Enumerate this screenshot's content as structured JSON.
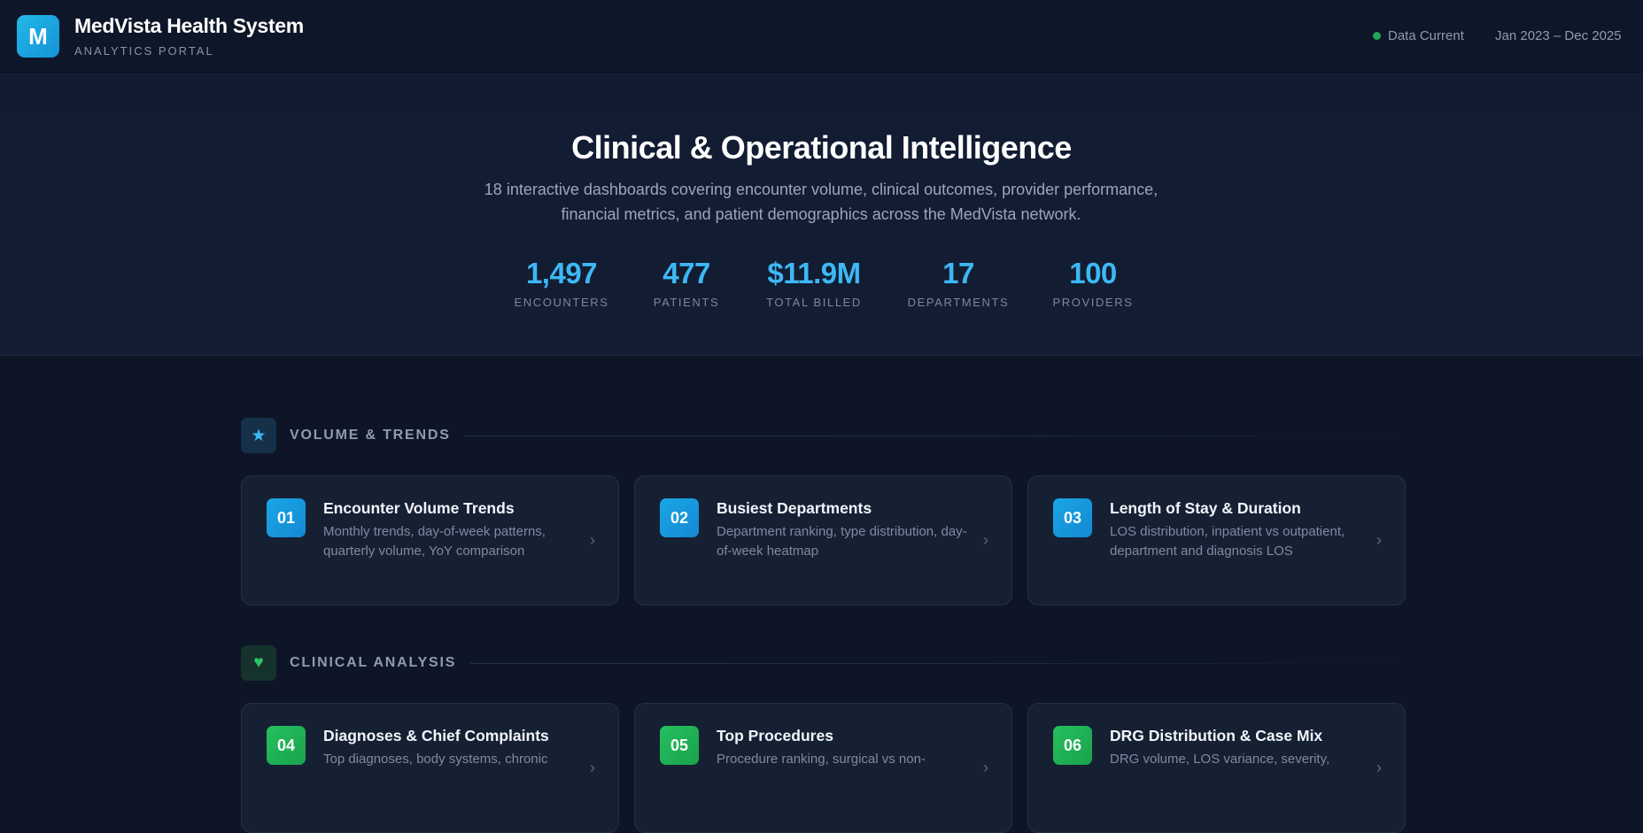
{
  "header": {
    "logo_letter": "M",
    "title": "MedVista Health System",
    "subtitle": "ANALYTICS PORTAL",
    "status": "Data Current",
    "date_range": "Jan 2023 – Dec 2025"
  },
  "hero": {
    "title": "Clinical & Operational Intelligence",
    "description": "18 interactive dashboards covering encounter volume, clinical outcomes, provider performance, financial metrics, and patient demographics across the MedVista network.",
    "stats": [
      {
        "value": "1,497",
        "label": "ENCOUNTERS"
      },
      {
        "value": "477",
        "label": "PATIENTS"
      },
      {
        "value": "$11.9M",
        "label": "TOTAL BILLED"
      },
      {
        "value": "17",
        "label": "DEPARTMENTS"
      },
      {
        "value": "100",
        "label": "PROVIDERS"
      }
    ]
  },
  "sections": [
    {
      "label": "VOLUME & TRENDS",
      "icon": "star-icon",
      "color": "#3db8f5",
      "cards": [
        {
          "num": "01",
          "title": "Encounter Volume Trends",
          "desc": "Monthly trends, day-of-week patterns, quarterly volume, YoY comparison"
        },
        {
          "num": "02",
          "title": "Busiest Departments",
          "desc": "Department ranking, type distribution, day-of-week heatmap"
        },
        {
          "num": "03",
          "title": "Length of Stay & Duration",
          "desc": "LOS distribution, inpatient vs outpatient, department and diagnosis LOS"
        }
      ]
    },
    {
      "label": "CLINICAL ANALYSIS",
      "icon": "heart-icon",
      "color": "#2fc36a",
      "cards": [
        {
          "num": "04",
          "title": "Diagnoses & Chief Complaints",
          "desc": "Top diagnoses, body systems, chronic"
        },
        {
          "num": "05",
          "title": "Top Procedures",
          "desc": "Procedure ranking, surgical vs non-"
        },
        {
          "num": "06",
          "title": "DRG Distribution & Case Mix",
          "desc": "DRG volume, LOS variance, severity,"
        }
      ]
    }
  ]
}
